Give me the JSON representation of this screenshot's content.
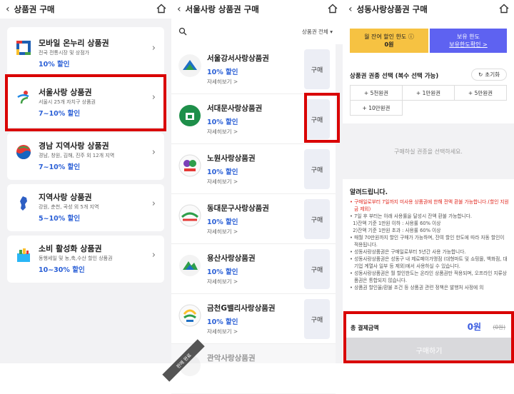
{
  "panel1": {
    "title": "상품권 구매",
    "cards": [
      {
        "name": "모바일 온누리 상품권",
        "sub": "전국 전통시장 및 상점가",
        "discount": "10% 할인"
      },
      {
        "name": "서울사랑 상품권",
        "sub": "서울시 25개 자치구 상품권",
        "discount": "7~10% 할인"
      },
      {
        "name": "경남 지역사랑 상품권",
        "sub": "경남, 창원, 김해, 진주 외 12개 지역",
        "discount": "7~10% 할인"
      },
      {
        "name": "지역사랑 상품권",
        "sub": "강원, 춘천, 곡성 외 5개 지역",
        "discount": "5~10% 할인"
      },
      {
        "name": "소비 활성화 상품권",
        "sub": "동행세일 및 농,축,수산 할인 상품권",
        "discount": "10~30% 할인"
      }
    ]
  },
  "panel2": {
    "title": "서울사랑 상품권 구매",
    "sort_label": "상품권 전체 ▾",
    "items": [
      {
        "name": "서울강서사랑상품권",
        "discount": "10% 할인",
        "detail": "자세히보기 >",
        "buy": "구매"
      },
      {
        "name": "서대문사랑상품권",
        "discount": "10% 할인",
        "detail": "자세히보기 >",
        "buy": "구매"
      },
      {
        "name": "노원사랑상품권",
        "discount": "10% 할인",
        "detail": "자세히보기 >",
        "buy": "구매"
      },
      {
        "name": "동대문구사랑상품권",
        "discount": "10% 할인",
        "detail": "자세히보기 >",
        "buy": "구매"
      },
      {
        "name": "용산사랑상품권",
        "discount": "10% 할인",
        "detail": "자세히보기 >",
        "buy": "구매"
      },
      {
        "name": "금천G밸리사랑상품권",
        "discount": "10% 할인",
        "detail": "자세히보기 >",
        "buy": "구매"
      },
      {
        "name": "관악사랑상품권",
        "discount": "",
        "detail": "",
        "buy": ""
      }
    ],
    "soldout_badge": "판매 완료"
  },
  "panel3": {
    "title": "성동사랑상품권 구매",
    "limit_left_label": "월 잔여 할인 한도 ⓘ",
    "limit_left_value": "0원",
    "limit_right_label": "보유 한도",
    "limit_right_link": "보유한도확인 >",
    "select_title": "상품권 권종 선택 (복수 선택 가능)",
    "reset_label": "초기화",
    "chips": [
      "+ 5천원권",
      "+ 1만원권",
      "+ 5만원권",
      "+ 10만원권"
    ],
    "empty_msg": "구매하실 권종을 선택하세요.",
    "notice_title": "알려드립니다.",
    "notices": [
      "구매일로부터 7일까지 미사용 상품권에 한해 전액 환불 가능합니다.(할인 지원금 제외)",
      "7일 후 부터는 아래 사용률을 달성시 잔액 환불 가능합니다.",
      "1)잔액 기준 1만원 이하 : 사용률 60% 이상",
      "2)잔액 기준 1만원 초과 : 사용률 60% 이상",
      "매월 70만원까지 할인 구매가 가능하며, 잔여 할인 한도에 따라 자동 할인이 적용됩니다.",
      "성동사랑상품권은 구매일로부터 5년간 사용 가능합니다.",
      "성동사랑상품권은 성동구 내 제로페이가맹점 (대형마트 및 쇼핑몰, 백화점, 대기업 계열사 일부 등 제외)에서 사용하실 수 있습니다.",
      "성동사랑상품권은 월 할인한도는 온라인 상품권만 적용되며, 오프라인 지류상품권은 통합되지 않습니다.",
      "상품권 할인율/환불 조건 등 상품권 관련 정책은 발행처 사정에 의"
    ],
    "pay_label": "총 결제금액",
    "pay_amount": "0원",
    "pay_original": "(0원)",
    "pay_button": "구매하기"
  }
}
